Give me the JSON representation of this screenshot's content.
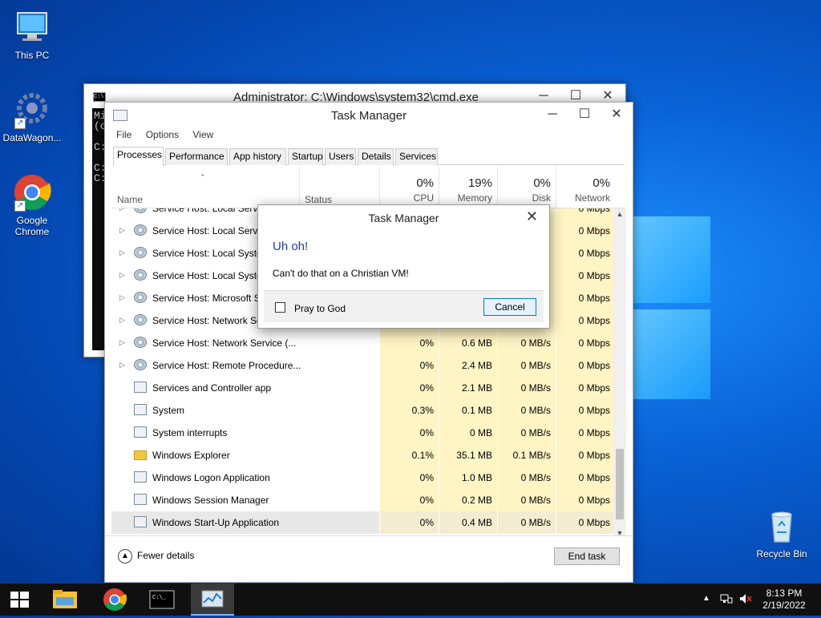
{
  "desktop": {
    "icons": [
      {
        "label": "This PC",
        "icon": "computer-icon"
      },
      {
        "label": "DataWagon...",
        "icon": "datawagon-icon"
      },
      {
        "label": "Google Chrome",
        "icon": "chrome-icon"
      },
      {
        "label": "Recycle Bin",
        "icon": "recycle-bin-icon"
      }
    ]
  },
  "cmd": {
    "title": "Administrator: C:\\Windows\\system32\\cmd.exe",
    "lines": [
      "Mi",
      "(c",
      "",
      "C:",
      "",
      "C:",
      "C:"
    ]
  },
  "taskmgr": {
    "title": "Task Manager",
    "menu": [
      "File",
      "Options",
      "View"
    ],
    "tabs": [
      "Processes",
      "Performance",
      "App history",
      "Startup",
      "Users",
      "Details",
      "Services"
    ],
    "columns": {
      "name": "Name",
      "status": "Status",
      "cpu": {
        "pct": "0%",
        "label": "CPU"
      },
      "memory": {
        "pct": "19%",
        "label": "Memory"
      },
      "disk": {
        "pct": "0%",
        "label": "Disk"
      },
      "network": {
        "pct": "0%",
        "label": "Network"
      }
    },
    "rows": [
      {
        "name": "Service Host: Local Servic",
        "icon": "gear",
        "expand": true,
        "cpu": "",
        "mem": "",
        "disk": "",
        "net": "0 Mbps"
      },
      {
        "name": "Service Host: Local Servic",
        "icon": "gear",
        "expand": true,
        "cpu": "",
        "mem": "",
        "disk": "",
        "net": "0 Mbps"
      },
      {
        "name": "Service Host: Local Syster",
        "icon": "gear",
        "expand": true,
        "cpu": "",
        "mem": "",
        "disk": "",
        "net": "0 Mbps"
      },
      {
        "name": "Service Host: Local Syster",
        "icon": "gear",
        "expand": true,
        "cpu": "",
        "mem": "",
        "disk": "",
        "net": "0 Mbps"
      },
      {
        "name": "Service Host: Microsoft S",
        "icon": "gear",
        "expand": true,
        "cpu": "",
        "mem": "",
        "disk": "",
        "net": "0 Mbps"
      },
      {
        "name": "Service Host: Network Se",
        "icon": "gear",
        "expand": true,
        "cpu": "",
        "mem": "",
        "disk": "",
        "net": "0 Mbps"
      },
      {
        "name": "Service Host: Network Service (...",
        "icon": "gear",
        "expand": true,
        "cpu": "0%",
        "mem": "0.6 MB",
        "disk": "0 MB/s",
        "net": "0 Mbps"
      },
      {
        "name": "Service Host: Remote Procedure...",
        "icon": "gear",
        "expand": true,
        "cpu": "0%",
        "mem": "2.4 MB",
        "disk": "0 MB/s",
        "net": "0 Mbps"
      },
      {
        "name": "Services and Controller app",
        "icon": "app",
        "expand": false,
        "cpu": "0%",
        "mem": "2.1 MB",
        "disk": "0 MB/s",
        "net": "0 Mbps"
      },
      {
        "name": "System",
        "icon": "app",
        "expand": false,
        "cpu": "0.3%",
        "mem": "0.1 MB",
        "disk": "0 MB/s",
        "net": "0 Mbps"
      },
      {
        "name": "System interrupts",
        "icon": "app",
        "expand": false,
        "cpu": "0%",
        "mem": "0 MB",
        "disk": "0 MB/s",
        "net": "0 Mbps"
      },
      {
        "name": "Windows Explorer",
        "icon": "folder",
        "expand": false,
        "cpu": "0.1%",
        "mem": "35.1 MB",
        "disk": "0.1 MB/s",
        "net": "0 Mbps"
      },
      {
        "name": "Windows Logon Application",
        "icon": "app",
        "expand": false,
        "cpu": "0%",
        "mem": "1.0 MB",
        "disk": "0 MB/s",
        "net": "0 Mbps"
      },
      {
        "name": "Windows Session Manager",
        "icon": "app",
        "expand": false,
        "cpu": "0%",
        "mem": "0.2 MB",
        "disk": "0 MB/s",
        "net": "0 Mbps"
      },
      {
        "name": "Windows Start-Up Application",
        "icon": "app",
        "expand": false,
        "cpu": "0%",
        "mem": "0.4 MB",
        "disk": "0 MB/s",
        "net": "0 Mbps",
        "selected": true
      }
    ],
    "fewer_details": "Fewer details",
    "end_task": "End task"
  },
  "dialog": {
    "title": "Task Manager",
    "heading": "Uh oh!",
    "message": "Can't do that on a Christian VM!",
    "checkbox_label": "Pray to God",
    "cancel": "Cancel"
  },
  "taskbar": {
    "time": "8:13 PM",
    "date": "2/19/2022"
  }
}
